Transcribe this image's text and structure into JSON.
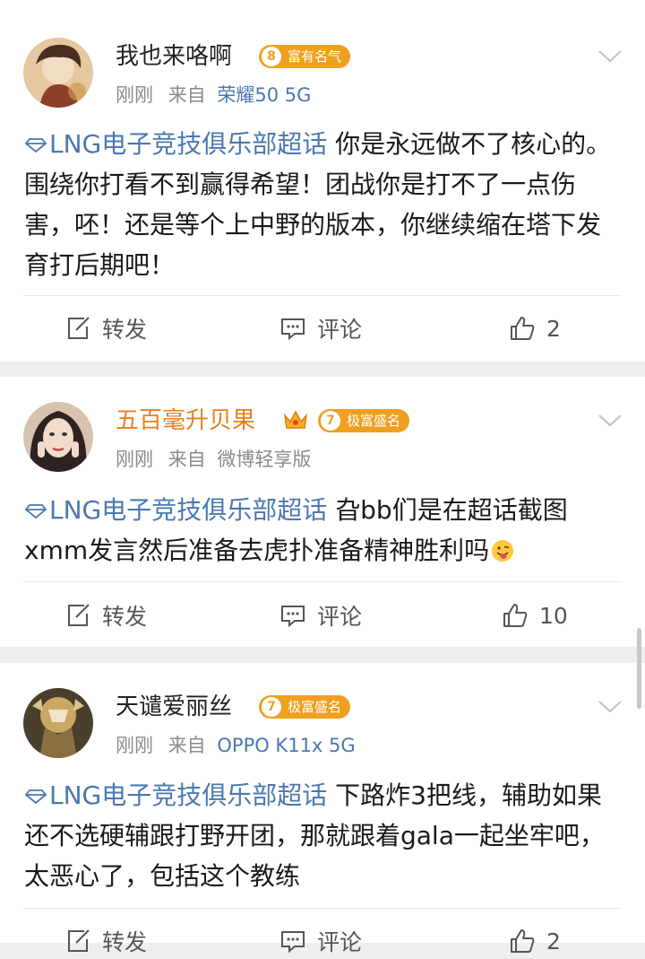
{
  "posts": [
    {
      "username": "我也来咯啊",
      "badge_level": "8",
      "badge_text": "富有名气",
      "time": "刚刚",
      "from": "来自",
      "device": "荣耀50 5G",
      "topic": "LNG电子竞技俱乐部超话",
      "text": "你是永远做不了核心的。围绕你打看不到赢得希望！团战你是打不了一点伤害，呸！还是等个上中野的版本，你继续缩在塔下发育打后期吧！",
      "repost_label": "转发",
      "comment_label": "评论",
      "like_count": "2"
    },
    {
      "username": "五百毫升贝果",
      "badge_level": "7",
      "badge_text": "极富盛名",
      "time": "刚刚",
      "from": "来自",
      "device": "微博轻享版",
      "topic": "LNG电子竞技俱乐部超话",
      "text": "旮bb们是在超话截图xmm发言然后准备去虎扑准备精神胜利吗",
      "repost_label": "转发",
      "comment_label": "评论",
      "like_count": "10"
    },
    {
      "username": "天谴爱丽丝",
      "badge_level": "7",
      "badge_text": "极富盛名",
      "time": "刚刚",
      "from": "来自",
      "device": "OPPO K11x 5G",
      "topic": "LNG电子竞技俱乐部超话",
      "text": "下路炸3把线，辅助如果还不选硬辅跟打野开团，那就跟着gala一起坐牢吧，太恶心了，包括这个教练",
      "repost_label": "转发",
      "comment_label": "评论",
      "like_count": "2"
    }
  ],
  "colors": {
    "link_blue": "#4a78b0",
    "vip_gold": "#e8801d",
    "badge_orange": "#f0a020",
    "separator": "#eeeeee"
  },
  "icons": [
    "topic-diamond-icon",
    "chevron-down-icon",
    "repost-icon",
    "comment-icon",
    "like-icon",
    "crown-icon",
    "tongue-emoji-icon"
  ]
}
